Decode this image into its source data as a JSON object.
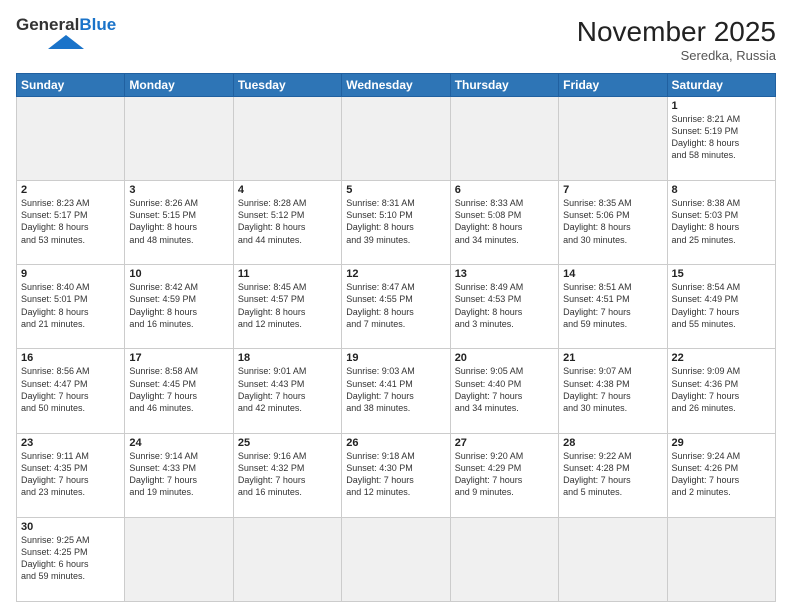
{
  "header": {
    "logo_general": "General",
    "logo_blue": "Blue",
    "month_year": "November 2025",
    "location": "Seredka, Russia"
  },
  "weekdays": [
    "Sunday",
    "Monday",
    "Tuesday",
    "Wednesday",
    "Thursday",
    "Friday",
    "Saturday"
  ],
  "days": [
    {
      "num": "",
      "info": "",
      "empty": true
    },
    {
      "num": "",
      "info": "",
      "empty": true
    },
    {
      "num": "",
      "info": "",
      "empty": true
    },
    {
      "num": "",
      "info": "",
      "empty": true
    },
    {
      "num": "",
      "info": "",
      "empty": true
    },
    {
      "num": "",
      "info": "",
      "empty": true
    },
    {
      "num": "1",
      "info": "Sunrise: 8:21 AM\nSunset: 5:19 PM\nDaylight: 8 hours\nand 58 minutes."
    },
    {
      "num": "2",
      "info": "Sunrise: 8:23 AM\nSunset: 5:17 PM\nDaylight: 8 hours\nand 53 minutes."
    },
    {
      "num": "3",
      "info": "Sunrise: 8:26 AM\nSunset: 5:15 PM\nDaylight: 8 hours\nand 48 minutes."
    },
    {
      "num": "4",
      "info": "Sunrise: 8:28 AM\nSunset: 5:12 PM\nDaylight: 8 hours\nand 44 minutes."
    },
    {
      "num": "5",
      "info": "Sunrise: 8:31 AM\nSunset: 5:10 PM\nDaylight: 8 hours\nand 39 minutes."
    },
    {
      "num": "6",
      "info": "Sunrise: 8:33 AM\nSunset: 5:08 PM\nDaylight: 8 hours\nand 34 minutes."
    },
    {
      "num": "7",
      "info": "Sunrise: 8:35 AM\nSunset: 5:06 PM\nDaylight: 8 hours\nand 30 minutes."
    },
    {
      "num": "8",
      "info": "Sunrise: 8:38 AM\nSunset: 5:03 PM\nDaylight: 8 hours\nand 25 minutes."
    },
    {
      "num": "9",
      "info": "Sunrise: 8:40 AM\nSunset: 5:01 PM\nDaylight: 8 hours\nand 21 minutes."
    },
    {
      "num": "10",
      "info": "Sunrise: 8:42 AM\nSunset: 4:59 PM\nDaylight: 8 hours\nand 16 minutes."
    },
    {
      "num": "11",
      "info": "Sunrise: 8:45 AM\nSunset: 4:57 PM\nDaylight: 8 hours\nand 12 minutes."
    },
    {
      "num": "12",
      "info": "Sunrise: 8:47 AM\nSunset: 4:55 PM\nDaylight: 8 hours\nand 7 minutes."
    },
    {
      "num": "13",
      "info": "Sunrise: 8:49 AM\nSunset: 4:53 PM\nDaylight: 8 hours\nand 3 minutes."
    },
    {
      "num": "14",
      "info": "Sunrise: 8:51 AM\nSunset: 4:51 PM\nDaylight: 7 hours\nand 59 minutes."
    },
    {
      "num": "15",
      "info": "Sunrise: 8:54 AM\nSunset: 4:49 PM\nDaylight: 7 hours\nand 55 minutes."
    },
    {
      "num": "16",
      "info": "Sunrise: 8:56 AM\nSunset: 4:47 PM\nDaylight: 7 hours\nand 50 minutes."
    },
    {
      "num": "17",
      "info": "Sunrise: 8:58 AM\nSunset: 4:45 PM\nDaylight: 7 hours\nand 46 minutes."
    },
    {
      "num": "18",
      "info": "Sunrise: 9:01 AM\nSunset: 4:43 PM\nDaylight: 7 hours\nand 42 minutes."
    },
    {
      "num": "19",
      "info": "Sunrise: 9:03 AM\nSunset: 4:41 PM\nDaylight: 7 hours\nand 38 minutes."
    },
    {
      "num": "20",
      "info": "Sunrise: 9:05 AM\nSunset: 4:40 PM\nDaylight: 7 hours\nand 34 minutes."
    },
    {
      "num": "21",
      "info": "Sunrise: 9:07 AM\nSunset: 4:38 PM\nDaylight: 7 hours\nand 30 minutes."
    },
    {
      "num": "22",
      "info": "Sunrise: 9:09 AM\nSunset: 4:36 PM\nDaylight: 7 hours\nand 26 minutes."
    },
    {
      "num": "23",
      "info": "Sunrise: 9:11 AM\nSunset: 4:35 PM\nDaylight: 7 hours\nand 23 minutes."
    },
    {
      "num": "24",
      "info": "Sunrise: 9:14 AM\nSunset: 4:33 PM\nDaylight: 7 hours\nand 19 minutes."
    },
    {
      "num": "25",
      "info": "Sunrise: 9:16 AM\nSunset: 4:32 PM\nDaylight: 7 hours\nand 16 minutes."
    },
    {
      "num": "26",
      "info": "Sunrise: 9:18 AM\nSunset: 4:30 PM\nDaylight: 7 hours\nand 12 minutes."
    },
    {
      "num": "27",
      "info": "Sunrise: 9:20 AM\nSunset: 4:29 PM\nDaylight: 7 hours\nand 9 minutes."
    },
    {
      "num": "28",
      "info": "Sunrise: 9:22 AM\nSunset: 4:28 PM\nDaylight: 7 hours\nand 5 minutes."
    },
    {
      "num": "29",
      "info": "Sunrise: 9:24 AM\nSunset: 4:26 PM\nDaylight: 7 hours\nand 2 minutes."
    },
    {
      "num": "30",
      "info": "Sunrise: 9:25 AM\nSunset: 4:25 PM\nDaylight: 6 hours\nand 59 minutes."
    },
    {
      "num": "",
      "info": "",
      "empty": true
    },
    {
      "num": "",
      "info": "",
      "empty": true
    },
    {
      "num": "",
      "info": "",
      "empty": true
    },
    {
      "num": "",
      "info": "",
      "empty": true
    },
    {
      "num": "",
      "info": "",
      "empty": true
    },
    {
      "num": "",
      "info": "",
      "empty": true
    }
  ]
}
